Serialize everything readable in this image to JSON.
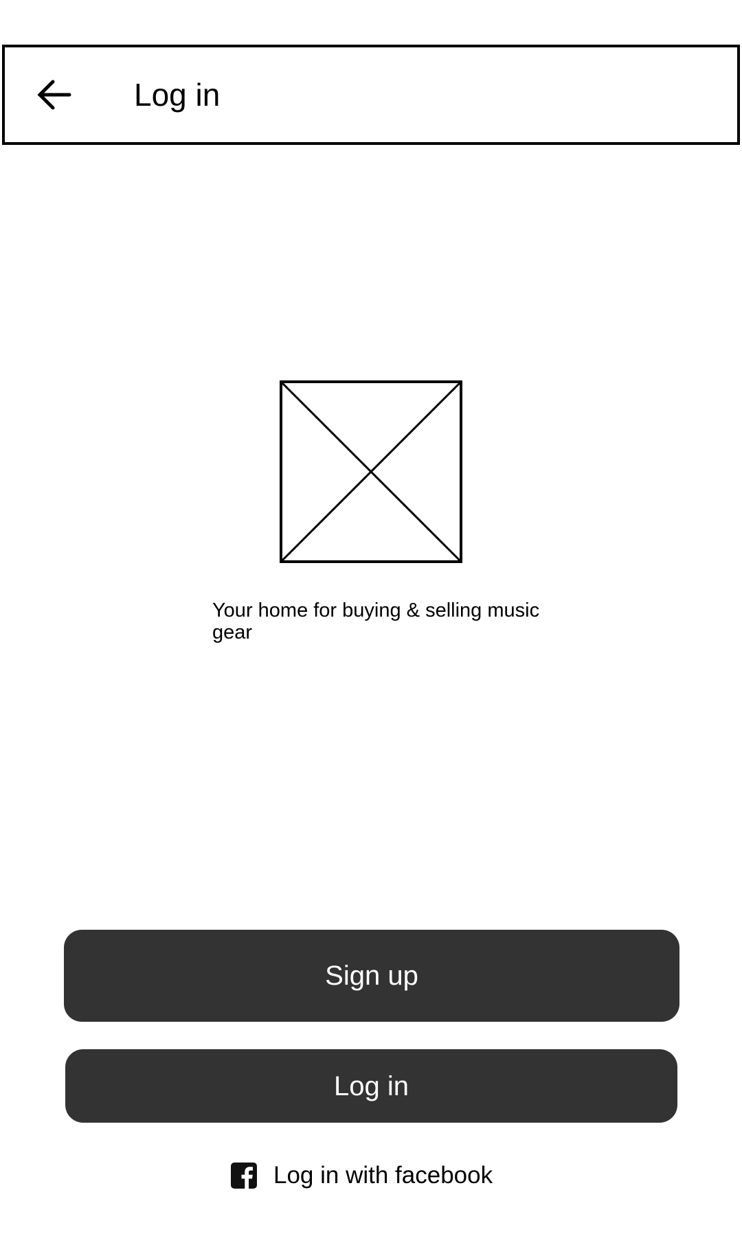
{
  "header": {
    "back_icon": "arrow-left-icon",
    "title": "Log in"
  },
  "logo": {
    "icon": "image-placeholder-icon"
  },
  "tagline": "Your home for buying & selling music gear",
  "actions": {
    "signup_label": "Sign up",
    "login_label": "Log in",
    "facebook_icon": "facebook-icon",
    "facebook_label": "Log in with facebook"
  },
  "colors": {
    "button_background": "#333333",
    "button_text": "#ffffff",
    "outline": "#000000",
    "background": "#ffffff"
  }
}
